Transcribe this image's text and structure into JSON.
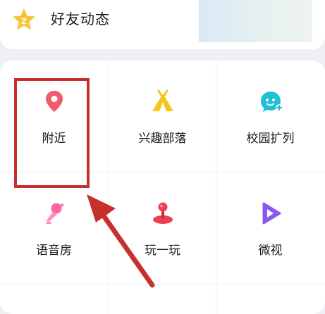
{
  "feed": {
    "label": "好友动态"
  },
  "grid": {
    "items": [
      {
        "label": "附近",
        "icon": "location-pin-icon"
      },
      {
        "label": "兴趣部落",
        "icon": "tent-icon"
      },
      {
        "label": "校园扩列",
        "icon": "campus-face-icon"
      },
      {
        "label": "语音房",
        "icon": "microphone-icon"
      },
      {
        "label": "玩一玩",
        "icon": "joystick-icon"
      },
      {
        "label": "微视",
        "icon": "play-icon"
      }
    ]
  },
  "colors": {
    "annotation": "#c6302d",
    "pin": "#f25a6a",
    "tent": "#f7c51e",
    "face": "#1fc0d6",
    "mic": "#ff62a5",
    "joystick": "#f03d4f",
    "play": "#8a58f0"
  }
}
